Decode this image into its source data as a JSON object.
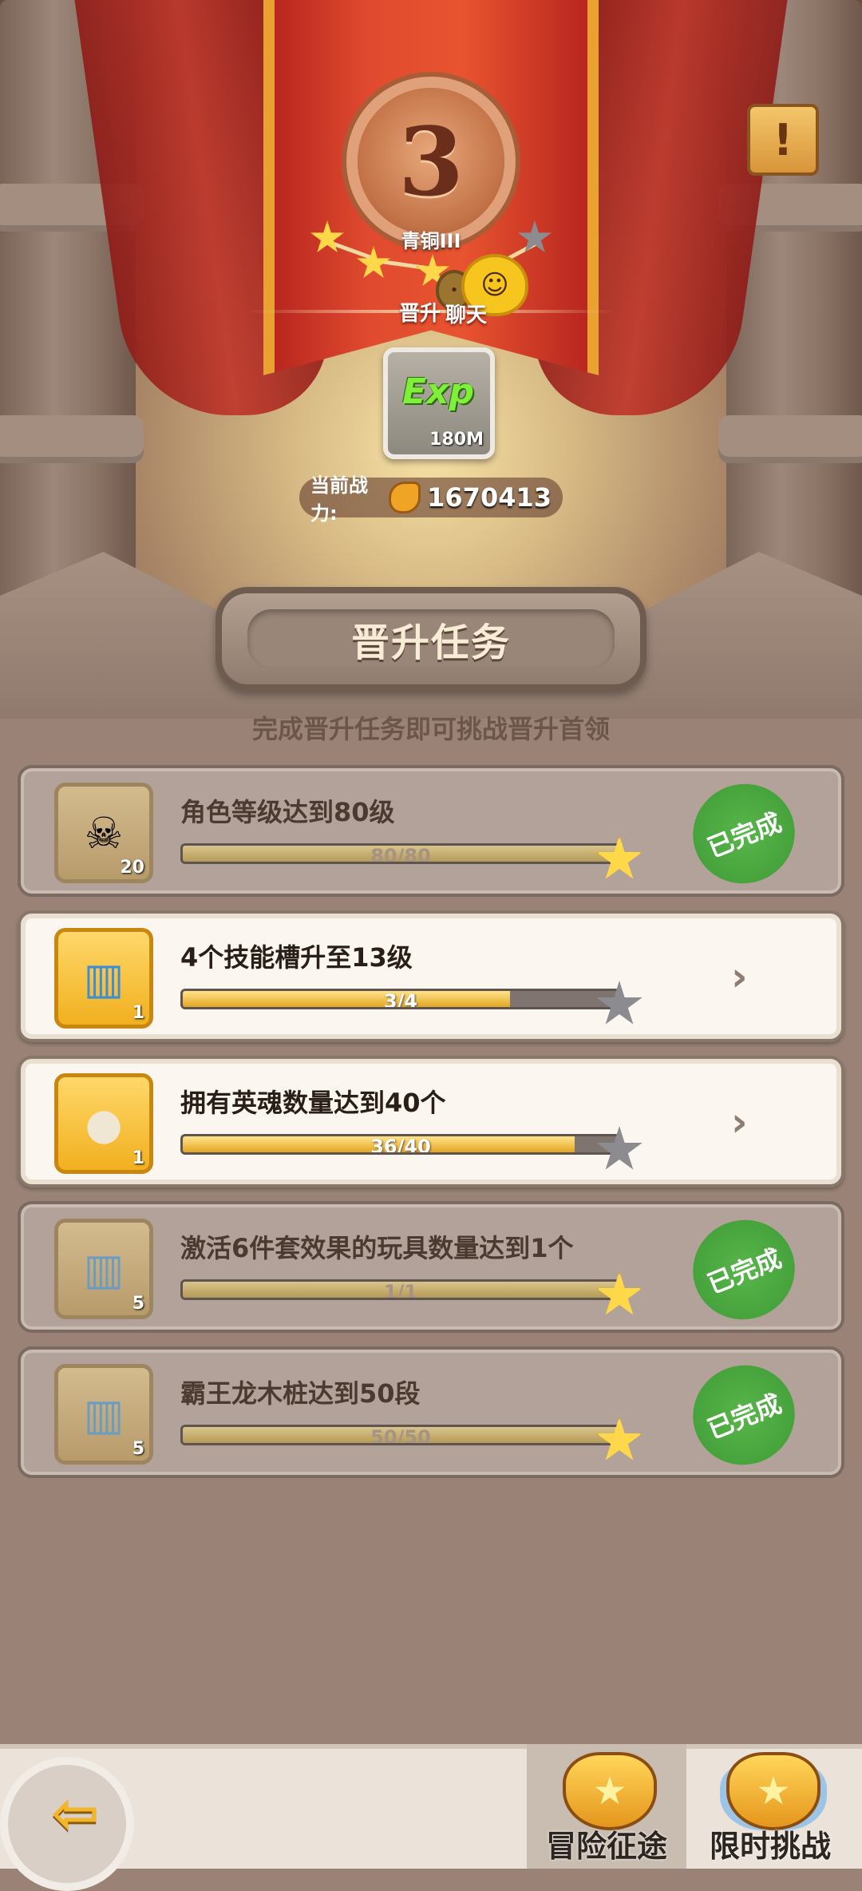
{
  "header": {
    "rank_number": "3",
    "rank_name": "青铜III",
    "promote_label": "晋升",
    "chat_label": "聊天",
    "stars_filled": 3,
    "stars_total": 4
  },
  "reward": {
    "icon": "exp-icon",
    "word": "Exp",
    "amount": "180M"
  },
  "power": {
    "label": "当前战力:",
    "value": "1670413"
  },
  "section": {
    "title": "晋升任务",
    "subtitle": "完成晋升任务即可挑战晋升首领"
  },
  "tasks": [
    {
      "title": "角色等级达到80级",
      "progress": "80/80",
      "fraction": 1.0,
      "count": "20",
      "icon": "dino-skull-icon",
      "status": "已完成",
      "completed": true
    },
    {
      "title": "4个技能槽升至13级",
      "progress": "3/4",
      "fraction": 0.75,
      "count": "1",
      "icon": "skill-scroll-icon",
      "status": "",
      "completed": false
    },
    {
      "title": "拥有英魂数量达到40个",
      "progress": "36/40",
      "fraction": 0.9,
      "count": "1",
      "icon": "egg-nest-icon",
      "status": "",
      "completed": false
    },
    {
      "title": "激活6件套效果的玩具数量达到1个",
      "progress": "1/1",
      "fraction": 1.0,
      "count": "5",
      "icon": "toy-scroll-icon",
      "status": "已完成",
      "completed": true
    },
    {
      "title": "霸王龙木桩达到50段",
      "progress": "50/50",
      "fraction": 1.0,
      "count": "5",
      "icon": "toy-scroll-icon",
      "status": "已完成",
      "completed": true
    }
  ],
  "nav": {
    "adventure_label": "冒险征途",
    "challenge_label": "限时挑战"
  },
  "colors": {
    "banner_red": "#e04a2f",
    "done_green": "#3f9a36",
    "gold": "#f1b01f"
  }
}
